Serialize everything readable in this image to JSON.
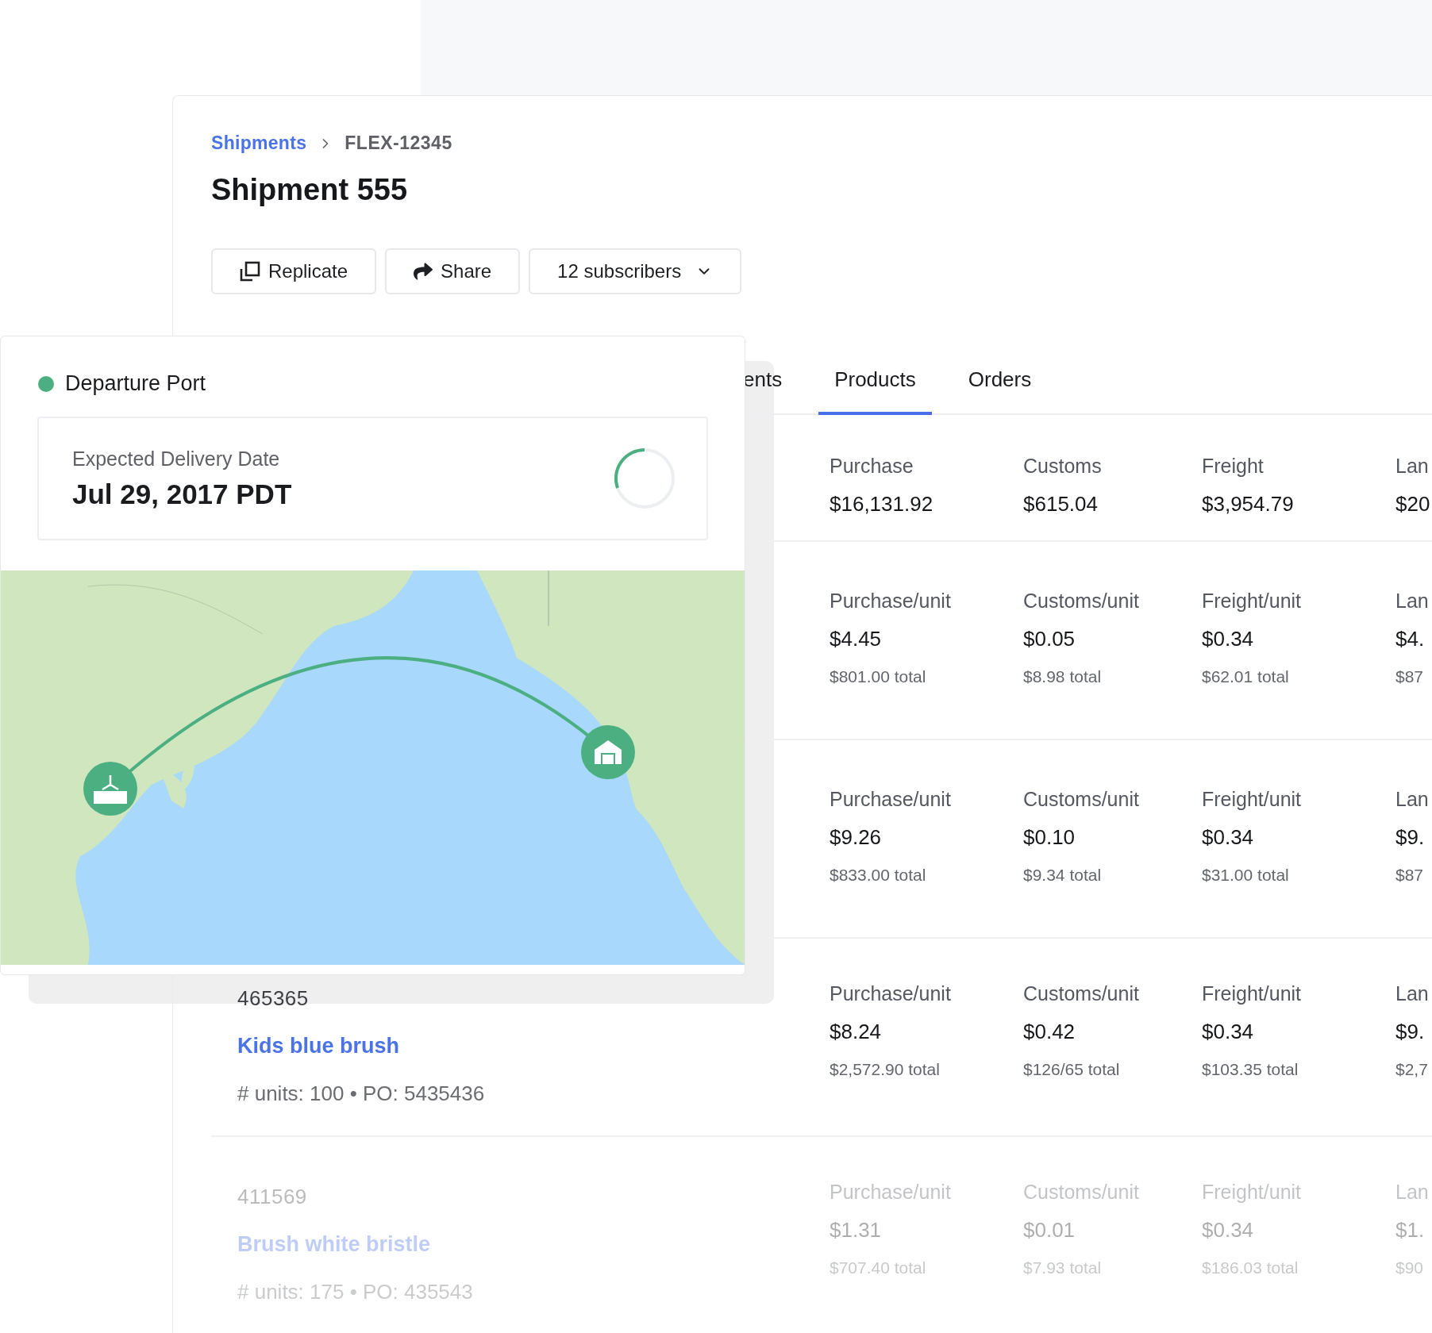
{
  "breadcrumb": [
    {
      "label": "Shipments",
      "kind": "link"
    },
    {
      "label": "FLEX-12345",
      "kind": "current"
    }
  ],
  "title": "Shipment 555",
  "actions": [
    {
      "label": "Replicate",
      "kind": "replicate"
    },
    {
      "label": "Share",
      "kind": "share"
    },
    {
      "label": "12 subscribers",
      "kind": "dropdown"
    }
  ],
  "tabs": [
    {
      "label": "ents",
      "selected": false
    },
    {
      "label": "Products",
      "selected": true
    },
    {
      "label": "Orders",
      "selected": false
    }
  ],
  "port_card": {
    "label": "Departure Port",
    "delivery_label": "Expected Delivery Date",
    "delivery_date": "Jul 29, 2017 PDT"
  },
  "summary": [
    {
      "label": "Purchase",
      "value": "$16,131.92"
    },
    {
      "label": "Customs",
      "value": "$615.04"
    },
    {
      "label": "Freight",
      "value": "$3,954.79"
    },
    {
      "label": "Lan",
      "value": "$20"
    }
  ],
  "products": [
    {
      "faded": false,
      "costs": [
        {
          "label": "Purchase/unit",
          "value": "$4.45",
          "total": "$801.00 total"
        },
        {
          "label": "Customs/unit",
          "value": "$0.05",
          "total": "$8.98 total"
        },
        {
          "label": "Freight/unit",
          "value": "$0.34",
          "total": "$62.01 total"
        },
        {
          "label": "Lan",
          "value": "$4.",
          "total": "$87"
        }
      ]
    },
    {
      "faded": false,
      "costs": [
        {
          "label": "Purchase/unit",
          "value": "$9.26",
          "total": "$833.00 total"
        },
        {
          "label": "Customs/unit",
          "value": "$0.10",
          "total": "$9.34 total"
        },
        {
          "label": "Freight/unit",
          "value": "$0.34",
          "total": "$31.00 total"
        },
        {
          "label": "Lan",
          "value": "$9.",
          "total": "$87"
        }
      ]
    },
    {
      "faded": false,
      "id": "465365",
      "name": "Kids blue brush",
      "meta": "# units: 100 • PO: 5435436",
      "costs": [
        {
          "label": "Purchase/unit",
          "value": "$8.24",
          "total": "$2,572.90 total"
        },
        {
          "label": "Customs/unit",
          "value": "$0.42",
          "total": "$126/65 total"
        },
        {
          "label": "Freight/unit",
          "value": "$0.34",
          "total": "$103.35 total"
        },
        {
          "label": "Lan",
          "value": "$9.",
          "total": "$2,7"
        }
      ]
    },
    {
      "faded": true,
      "id": "411569",
      "name": "Brush white bristle",
      "meta": "# units: 175 • PO: 435543",
      "costs": [
        {
          "label": "Purchase/unit",
          "value": "$1.31",
          "total": "$707.40 total"
        },
        {
          "label": "Customs/unit",
          "value": "$0.01",
          "total": "$7.93 total"
        },
        {
          "label": "Freight/unit",
          "value": "$0.34",
          "total": "$186.03 total"
        },
        {
          "label": "Lan",
          "value": "$1.",
          "total": "$90"
        }
      ]
    }
  ]
}
